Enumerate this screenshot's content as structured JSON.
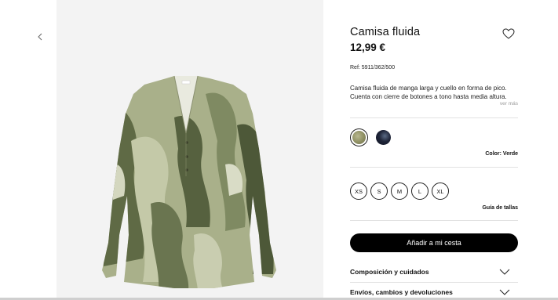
{
  "product": {
    "name": "Camisa fluida",
    "price": "12,99 €",
    "ref": "Ref: 5911/362/500",
    "description": "Camisa fluida de manga larga y cuello en forma de pico. Cuenta con cierre de botones a tono hasta media altura.",
    "see_more": "ver más"
  },
  "colors": {
    "selected_label": "Color: Verde",
    "options": [
      {
        "name": "verde",
        "hex": "#8e8f62"
      },
      {
        "name": "marino",
        "hex": "#1e2438"
      }
    ]
  },
  "sizes": {
    "options": [
      "XS",
      "S",
      "M",
      "L",
      "XL"
    ],
    "guide_label": "Guía de tallas"
  },
  "actions": {
    "add_to_cart": "Añadir a mi cesta"
  },
  "accordions": [
    {
      "label": "Composición y cuidados"
    },
    {
      "label": "Envíos, cambios y devoluciones"
    }
  ],
  "icons": {
    "prev": "chevron-left-icon",
    "wishlist": "heart-icon",
    "expand": "chevron-down-icon"
  }
}
